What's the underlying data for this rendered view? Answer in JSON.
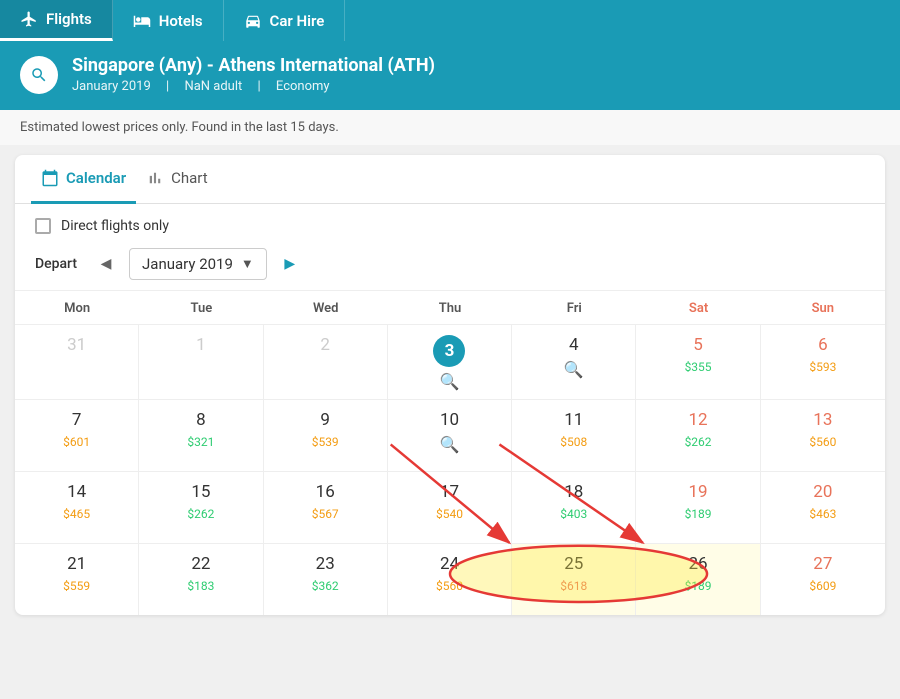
{
  "nav": {
    "tabs": [
      {
        "id": "flights",
        "label": "Flights",
        "active": true
      },
      {
        "id": "hotels",
        "label": "Hotels",
        "active": false
      },
      {
        "id": "car-hire",
        "label": "Car Hire",
        "active": false
      }
    ]
  },
  "search": {
    "route": "Singapore (Any) - Athens International (ATH)",
    "month": "January 2019",
    "adults": "NaN adult",
    "class": "Economy"
  },
  "notice": "Estimated lowest prices only. Found in the last 15 days.",
  "tabs": {
    "calendar": "Calendar",
    "chart": "Chart"
  },
  "controls": {
    "direct_flights": "Direct flights only",
    "depart": "Depart",
    "month": "January 2019"
  },
  "days_header": [
    "Mon",
    "Tue",
    "Wed",
    "Thu",
    "Fri",
    "Sat",
    "Sun"
  ],
  "calendar": {
    "rows": [
      [
        {
          "day": "31",
          "inactive": true,
          "price": null,
          "priceColor": null,
          "search": false
        },
        {
          "day": "1",
          "inactive": true,
          "price": null,
          "priceColor": null,
          "search": false
        },
        {
          "day": "2",
          "inactive": true,
          "price": null,
          "priceColor": null,
          "search": false
        },
        {
          "day": "3",
          "inactive": false,
          "today": true,
          "price": null,
          "priceColor": null,
          "search": true
        },
        {
          "day": "4",
          "inactive": false,
          "price": null,
          "priceColor": null,
          "search": true
        },
        {
          "day": "5",
          "inactive": false,
          "price": "$355",
          "priceColor": "green",
          "search": false,
          "weekend": "sat"
        },
        {
          "day": "6",
          "inactive": false,
          "price": "$593",
          "priceColor": "orange",
          "search": false,
          "weekend": "sun"
        }
      ],
      [
        {
          "day": "7",
          "inactive": false,
          "price": "$601",
          "priceColor": "orange",
          "search": false
        },
        {
          "day": "8",
          "inactive": false,
          "price": "$321",
          "priceColor": "green",
          "search": false
        },
        {
          "day": "9",
          "inactive": false,
          "price": "$539",
          "priceColor": "orange",
          "search": false
        },
        {
          "day": "10",
          "inactive": false,
          "price": null,
          "priceColor": null,
          "search": true
        },
        {
          "day": "11",
          "inactive": false,
          "price": "$508",
          "priceColor": "orange",
          "search": false
        },
        {
          "day": "12",
          "inactive": false,
          "price": "$262",
          "priceColor": "green",
          "search": false,
          "weekend": "sat"
        },
        {
          "day": "13",
          "inactive": false,
          "price": "$560",
          "priceColor": "orange",
          "search": false,
          "weekend": "sun"
        }
      ],
      [
        {
          "day": "14",
          "inactive": false,
          "price": "$465",
          "priceColor": "orange",
          "search": false
        },
        {
          "day": "15",
          "inactive": false,
          "price": "$262",
          "priceColor": "green",
          "search": false
        },
        {
          "day": "16",
          "inactive": false,
          "price": "$567",
          "priceColor": "orange",
          "search": false
        },
        {
          "day": "17",
          "inactive": false,
          "price": "$540",
          "priceColor": "orange",
          "search": false
        },
        {
          "day": "18",
          "inactive": false,
          "price": "$403",
          "priceColor": "green",
          "search": false
        },
        {
          "day": "19",
          "inactive": false,
          "price": "$189",
          "priceColor": "green",
          "search": false,
          "weekend": "sat"
        },
        {
          "day": "20",
          "inactive": false,
          "price": "$463",
          "priceColor": "orange",
          "search": false,
          "weekend": "sun"
        }
      ],
      [
        {
          "day": "21",
          "inactive": false,
          "price": "$559",
          "priceColor": "orange",
          "search": false
        },
        {
          "day": "22",
          "inactive": false,
          "price": "$183",
          "priceColor": "green",
          "search": false
        },
        {
          "day": "23",
          "inactive": false,
          "price": "$362",
          "priceColor": "green",
          "search": false
        },
        {
          "day": "24",
          "inactive": false,
          "price": "$560",
          "priceColor": "orange",
          "search": false
        },
        {
          "day": "25",
          "inactive": false,
          "price": "$618",
          "priceColor": "red",
          "search": false,
          "highlight": true
        },
        {
          "day": "26",
          "inactive": false,
          "price": "$189",
          "priceColor": "green",
          "search": false,
          "weekend": "sat",
          "highlight": true
        },
        {
          "day": "27",
          "inactive": false,
          "price": "$609",
          "priceColor": "orange",
          "search": false,
          "weekend": "sun"
        }
      ]
    ]
  }
}
